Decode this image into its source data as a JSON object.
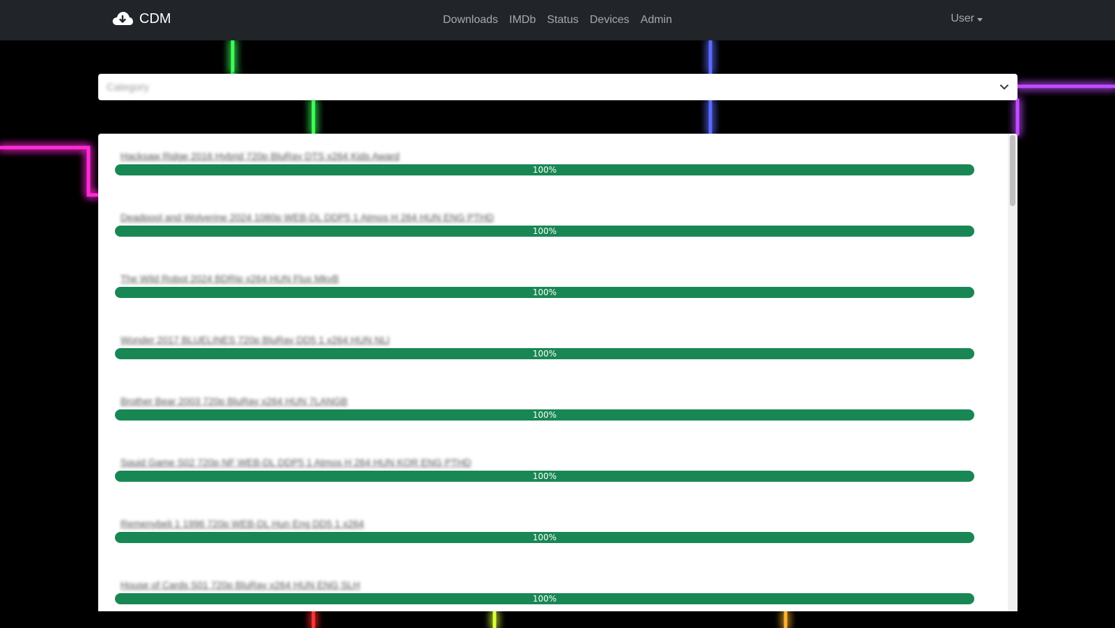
{
  "navbar": {
    "brand": "CDM",
    "links": [
      "Downloads",
      "IMDb",
      "Status",
      "Devices",
      "Admin"
    ],
    "user": "User"
  },
  "category_select": {
    "placeholder": "Category"
  },
  "downloads": [
    {
      "title": "Hacksaw Ridge 2016 Hybrid 720p BluRay DTS x264 Kids Award",
      "progress": "100%"
    },
    {
      "title": "Deadpool and Wolverine 2024 1080p WEB-DL DDP5 1 Atmos H 264 HUN ENG PTHD",
      "progress": "100%"
    },
    {
      "title": "The Wild Robot 2024 BDRip x264 HUN Flux MkvB",
      "progress": "100%"
    },
    {
      "title": "Wonder 2017 BLUELINES 720p BluRay DD5 1 x264 HUN NLI",
      "progress": "100%"
    },
    {
      "title": "Brother Bear 2003 720p BluRay x264 HUN 7LANGB",
      "progress": "100%"
    },
    {
      "title": "Squid Game S02 720p NF WEB-DL DDP5 1 Atmos H 264 HUN KOR ENG PTHD",
      "progress": "100%"
    },
    {
      "title": "Remenybeli 1 1996 720p WEB-DL Hun Eng DD5 1 x264",
      "progress": "100%"
    },
    {
      "title": "House of Cards S01 720p BluRay x264 HUN ENG SLH",
      "progress": "100%"
    }
  ],
  "colors": {
    "navbar": "#212529",
    "progress": "#198754",
    "background": "#000000"
  }
}
